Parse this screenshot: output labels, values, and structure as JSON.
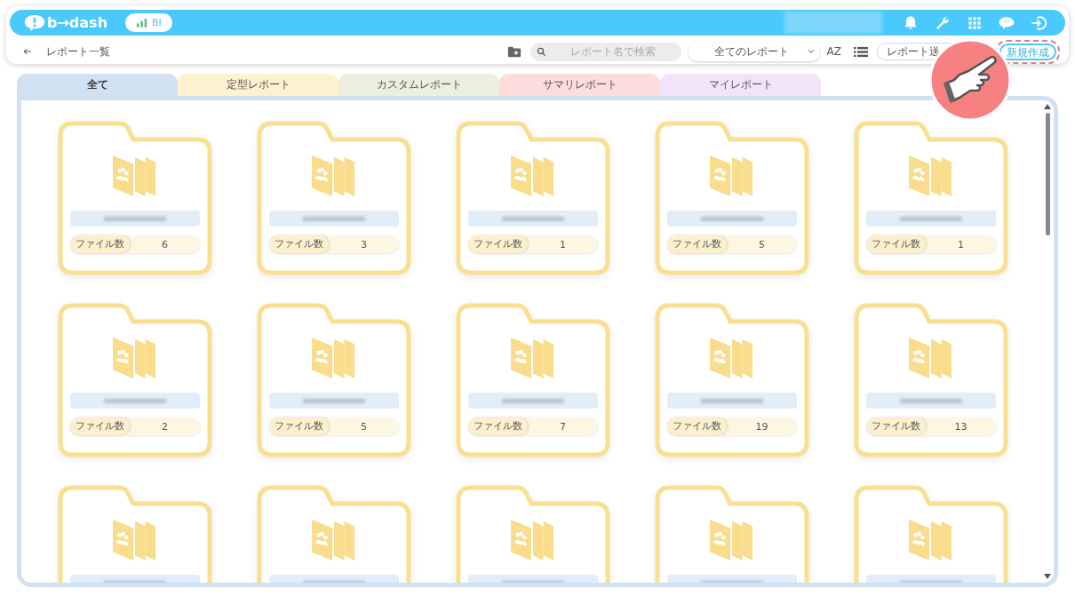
{
  "header": {
    "logo": "b→dash",
    "badge": "BI"
  },
  "toolbar": {
    "title": "レポート一覧",
    "search": {
      "placeholder": "レポート名で検索"
    },
    "filter": {
      "value": "全てのレポート"
    },
    "sort_label": "AZ",
    "send_button": "レポート送",
    "new_button": {
      "label": "新規作成",
      "highlighted": true
    }
  },
  "tabs": [
    {
      "label": "全て",
      "selected": true,
      "color": "#d0e2f2"
    },
    {
      "label": "定型レポート",
      "selected": false,
      "color": "#fdf1cf"
    },
    {
      "label": "カスタムレポート",
      "selected": false,
      "color": "#ebefdb"
    },
    {
      "label": "サマリレポート",
      "selected": false,
      "color": "#fddcdc"
    },
    {
      "label": "マイレポート",
      "selected": false,
      "color": "#f2e3fb"
    }
  ],
  "cards": [
    {
      "count_label": "ファイル数",
      "count": "6"
    },
    {
      "count_label": "ファイル数",
      "count": "3"
    },
    {
      "count_label": "ファイル数",
      "count": "1"
    },
    {
      "count_label": "ファイル数",
      "count": "5"
    },
    {
      "count_label": "ファイル数",
      "count": "1"
    },
    {
      "count_label": "ファイル数",
      "count": "2"
    },
    {
      "count_label": "ファイル数",
      "count": "5"
    },
    {
      "count_label": "ファイル数",
      "count": "7"
    },
    {
      "count_label": "ファイル数",
      "count": "19"
    },
    {
      "count_label": "ファイル数",
      "count": "13"
    },
    {
      "kind": "folder"
    },
    {
      "kind": "folder"
    },
    {
      "kind": "folder"
    },
    {
      "kind": "folder"
    },
    {
      "kind": "folder"
    }
  ]
}
